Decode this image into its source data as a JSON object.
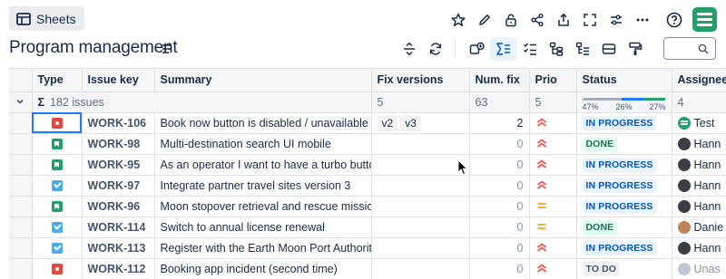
{
  "header": {
    "sheets_label": "Sheets",
    "title": "Program management",
    "search_value": ""
  },
  "top_icons": [
    "star-icon",
    "pencil-icon",
    "lock-icon",
    "share-icon",
    "export-icon",
    "fullscreen-icon",
    "sliders-icon",
    "more-icon",
    "help-icon",
    "app-logo"
  ],
  "toolbar_icons": [
    "row-height-icon",
    "refresh-icon",
    "hierarchy-add-icon",
    "sum-icon",
    "checklist-icon",
    "tree-icon",
    "tree-settings-icon",
    "group-icon",
    "format-painter-icon"
  ],
  "columns": {
    "type": "Type",
    "issue_key": "Issue key",
    "summary": "Summary",
    "fix_versions": "Fix versions",
    "num_fix": "Num. fix",
    "prio": "Prio",
    "status": "Status",
    "assignee": "Assignee"
  },
  "summary_row": {
    "sigma": "Σ",
    "issues": "182 issues",
    "fix_versions": "5",
    "num_fix": "63",
    "prio": "5",
    "status_pcts": [
      "47%",
      "26%",
      "27%"
    ],
    "status_fractions": [
      0.47,
      0.26,
      0.27
    ],
    "status_colors": [
      "#a5adba",
      "#1d7afc",
      "#22a06b"
    ],
    "assignee": "4"
  },
  "rows": [
    {
      "type": "bug",
      "key": "WORK-106",
      "summary": "Book now button is disabled / unavailable",
      "versions": [
        "v2",
        "v3"
      ],
      "num": "2",
      "prio": "high",
      "status": "IN PROGRESS",
      "status_kind": "prog",
      "assignee": "Test",
      "avatar": "green"
    },
    {
      "type": "story",
      "key": "WORK-98",
      "summary": "Multi-destination search UI mobile",
      "versions": [],
      "num": "0",
      "prio": "high",
      "status": "DONE",
      "status_kind": "done",
      "assignee": "Hann",
      "avatar": "dark"
    },
    {
      "type": "story",
      "key": "WORK-95",
      "summary": "As an operator I want to have a turbo button",
      "versions": [],
      "num": "0",
      "prio": "high",
      "status": "IN PROGRESS",
      "status_kind": "prog",
      "assignee": "Hann",
      "avatar": "dark"
    },
    {
      "type": "task",
      "key": "WORK-97",
      "summary": "Integrate partner travel sites version 3",
      "versions": [],
      "num": "0",
      "prio": "high",
      "status": "IN PROGRESS",
      "status_kind": "prog",
      "assignee": "Hann",
      "avatar": "dark"
    },
    {
      "type": "story",
      "key": "WORK-96",
      "summary": "Moon stopover retrieval and rescue mission...",
      "versions": [],
      "num": "0",
      "prio": "medium",
      "status": "IN PROGRESS",
      "status_kind": "prog",
      "assignee": "Hann",
      "avatar": "dark"
    },
    {
      "type": "task",
      "key": "WORK-114",
      "summary": "Switch to annual license renewal",
      "versions": [],
      "num": "0",
      "prio": "medium",
      "status": "DONE",
      "status_kind": "done",
      "assignee": "Danie",
      "avatar": "brown"
    },
    {
      "type": "task",
      "key": "WORK-113",
      "summary": "Register with the Earth Moon Port Authority",
      "versions": [],
      "num": "0",
      "prio": "high",
      "status": "IN PROGRESS",
      "status_kind": "prog",
      "assignee": "Hann",
      "avatar": "dark"
    },
    {
      "type": "bug",
      "key": "WORK-112",
      "summary": "Booking app incident (second time)",
      "versions": [],
      "num": "0",
      "prio": "high",
      "status": "TO DO",
      "status_kind": "todo",
      "assignee": "Unas",
      "avatar": "grey"
    }
  ]
}
